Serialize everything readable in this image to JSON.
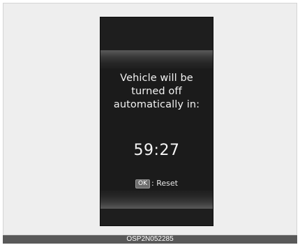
{
  "display": {
    "message_lines": [
      "Vehicle will be",
      "turned off",
      "automatically in:"
    ],
    "countdown": "59:27",
    "button_key": "OK",
    "button_action": ": Reset"
  },
  "footer": {
    "code": "OSP2N052285"
  },
  "colors": {
    "screen_background": "#1b1b1b",
    "text": "#f2f2f2",
    "footer_bar": "#595959",
    "frame_background": "#eeeeee"
  }
}
